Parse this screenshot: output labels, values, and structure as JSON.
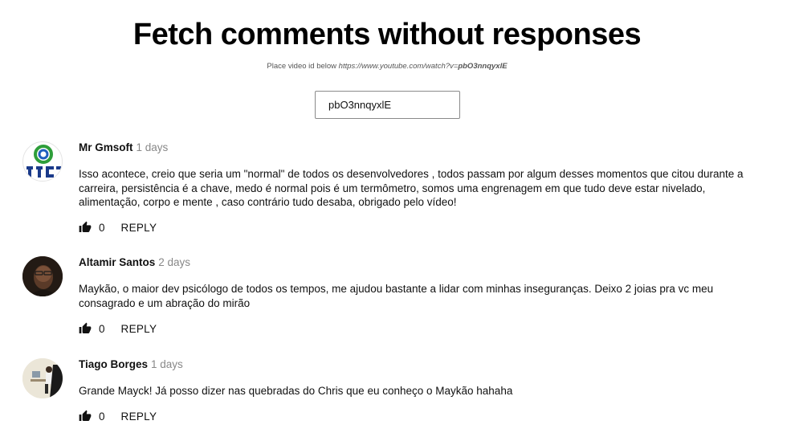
{
  "page": {
    "title": "Fetch comments without responses",
    "hint_prefix": "Place video id below",
    "hint_url": "https://www.youtube.com/watch?v=",
    "hint_video_id": "pbO3nnqyxlE"
  },
  "search": {
    "value": "pbO3nnqyxlE"
  },
  "comments": [
    {
      "author": "Mr Gmsoft",
      "time": "1 days",
      "text": "Isso acontece, creio que seria um \"normal\" de todos os desenvolvedores , todos passam por algum desses momentos que citou durante a carreira, persistência é a chave, medo é normal pois é um termômetro, somos uma engrenagem em que tudo deve estar nivelado, alimentação, corpo e mente , caso contrário tudo desaba, obrigado pelo vídeo!",
      "likes": "0",
      "reply_label": "REPLY",
      "avatar_icon": "gmsoft-logo"
    },
    {
      "author": "Altamir Santos",
      "time": "2 days",
      "text": "Maykão, o maior dev psicólogo de todos os tempos, me ajudou bastante a lidar com minhas inseguranças. Deixo 2 joias pra vc meu consagrado e um abração do mirão",
      "likes": "0",
      "reply_label": "REPLY",
      "avatar_icon": "user-photo"
    },
    {
      "author": "Tiago Borges",
      "time": "1 days",
      "text": "Grande Mayck! Já posso dizer nas quebradas do Chris que eu conheço o Maykão hahaha",
      "likes": "0",
      "reply_label": "REPLY",
      "avatar_icon": "user-photo"
    }
  ],
  "icons": {
    "like": "thumbs-up-icon"
  }
}
